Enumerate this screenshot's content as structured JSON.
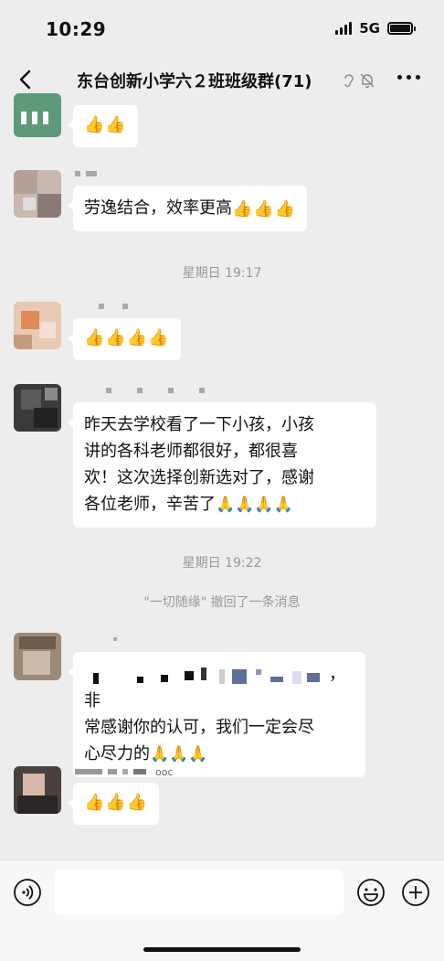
{
  "status": {
    "time": "10:29",
    "network": "5G"
  },
  "header": {
    "title": "东台创新小学六２班班级群(71)"
  },
  "messages": {
    "m1": {
      "text": ""
    },
    "m2": {
      "text": "劳逸结合，效率更高"
    },
    "time1": "星期日 19:17",
    "m4": {
      "text_line1": "昨天去学校看了一下小孩，小孩",
      "text_line2": "讲的各科老师都很好，都很喜",
      "text_line3": "欢！这次选择创新选对了，感谢",
      "text_line4": "各位老师，辛苦了"
    },
    "time2": "星期日 19:22",
    "recall": "\"一切随缘\" 撤回了一条消息",
    "m6": {
      "text_line1_end": "，非",
      "text_line2": "常感谢你的认可，我们一定会尽",
      "text_line3": "心尽力的"
    },
    "m7": {
      "name_fragment": "ooc"
    }
  },
  "emoji": {
    "thumbs_up": "👍",
    "pray": "🙏"
  },
  "icons": {
    "back": "chevron-left-icon",
    "ear": "ear-icon",
    "mute": "bell-slash-icon",
    "more": "more-icon",
    "voice": "voice-icon",
    "emoji": "emoji-icon",
    "plus": "plus-icon"
  },
  "colors": {
    "background": "#ededed",
    "bubble": "#ffffff",
    "system_text": "#999999"
  }
}
